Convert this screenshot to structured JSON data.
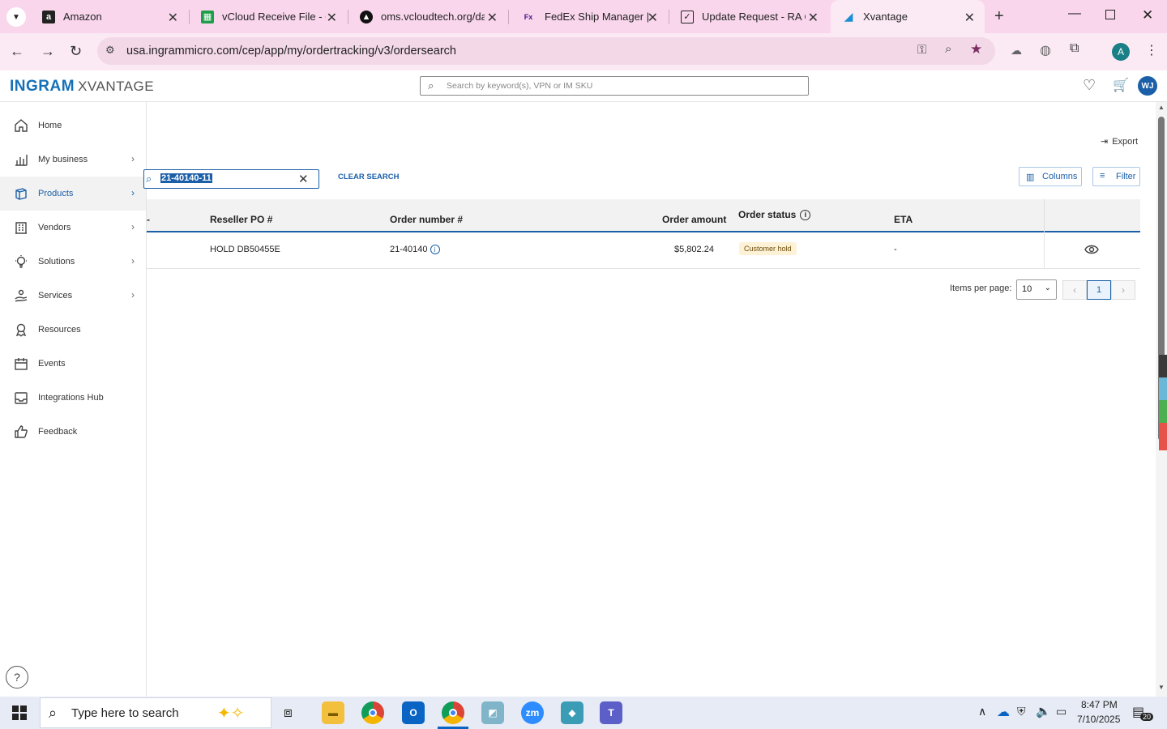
{
  "browser": {
    "tabs": [
      {
        "title": "Amazon",
        "icon": "amazon-icon"
      },
      {
        "title": "vCloud Receive File - Go",
        "icon": "sheets-icon"
      },
      {
        "title": "oms.vcloudtech.org/da",
        "icon": "oms-icon"
      },
      {
        "title": "FedEx Ship Manager | C",
        "icon": "fedex-icon"
      },
      {
        "title": "Update Request - RA Qu",
        "icon": "checkmark-icon"
      },
      {
        "title": "Xvantage",
        "icon": "xvantage-icon"
      }
    ],
    "url": "usa.ingrammicro.com/cep/app/my/ordertracking/v3/ordersearch",
    "profile_initial": "A"
  },
  "header": {
    "logo_main": "INGRAM",
    "logo_sub": "XVANTAGE",
    "search_placeholder": "Search by keyword(s), VPN or IM SKU",
    "user_initials": "WJ"
  },
  "sidebar": {
    "items": [
      {
        "label": "Home",
        "icon": "home-icon",
        "chevron": false
      },
      {
        "label": "My business",
        "icon": "chart-icon",
        "chevron": true
      },
      {
        "label": "Products",
        "icon": "box-icon",
        "chevron": true,
        "active": true
      },
      {
        "label": "Vendors",
        "icon": "building-icon",
        "chevron": true
      },
      {
        "label": "Solutions",
        "icon": "lightbulb-icon",
        "chevron": true
      },
      {
        "label": "Services",
        "icon": "hand-icon",
        "chevron": true
      },
      {
        "label": "Resources",
        "icon": "award-icon",
        "chevron": false
      },
      {
        "label": "Events",
        "icon": "calendar-icon",
        "chevron": false
      },
      {
        "label": "Integrations Hub",
        "icon": "inbox-icon",
        "chevron": false
      },
      {
        "label": "Feedback",
        "icon": "thumbs-up-icon",
        "chevron": false
      }
    ]
  },
  "main": {
    "export_label": "Export",
    "search_value": "21-40140-11",
    "clear_search_label": "CLEAR SEARCH",
    "columns_label": "Columns",
    "filter_label": "Filter",
    "table": {
      "headers": [
        "-",
        "Reseller PO #",
        "Order number #",
        "Order amount",
        "Order status",
        "ETA"
      ],
      "rows": [
        {
          "reseller_po": "HOLD DB50455E",
          "order_number": "21-40140",
          "order_amount": "$5,802.24",
          "order_status": "Customer hold",
          "eta": "-"
        }
      ]
    },
    "pagination": {
      "items_per_page_label": "Items per page:",
      "items_per_page_value": "10",
      "current_page": "1"
    }
  },
  "taskbar": {
    "search_placeholder": "Type here to search",
    "time": "8:47 PM",
    "date": "7/10/2025",
    "notification_count": "20"
  }
}
